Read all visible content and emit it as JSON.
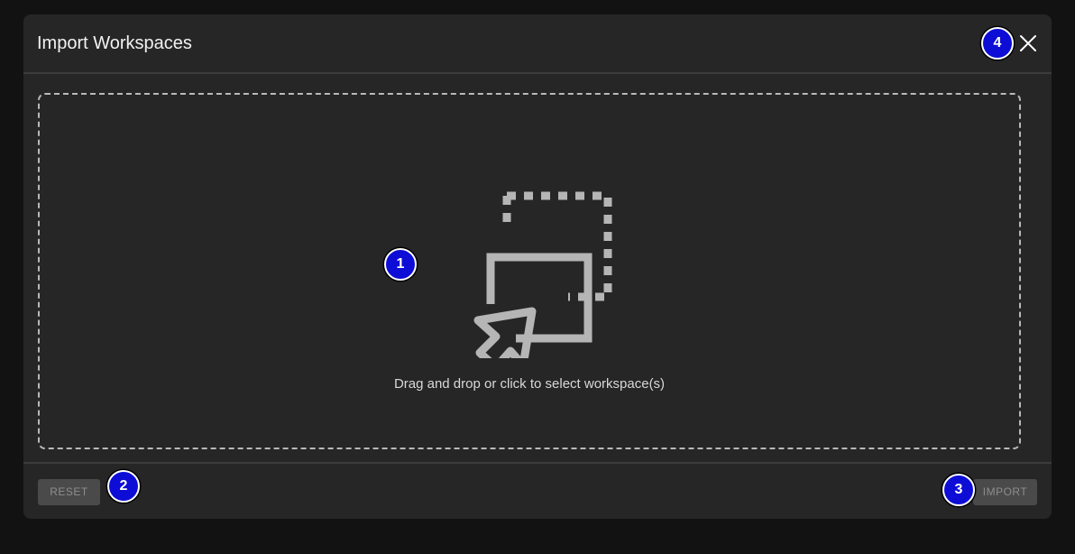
{
  "dialog": {
    "title": "Import Workspaces",
    "close_icon": "close-icon"
  },
  "dropzone": {
    "icon": "drag-drop-select-icon",
    "text": "Drag and drop or click to select workspace(s)"
  },
  "footer": {
    "reset_label": "RESET",
    "import_label": "IMPORT"
  },
  "markers": [
    "1",
    "2",
    "3",
    "4"
  ],
  "colors": {
    "page_background": "#121212",
    "dialog_background": "#262626",
    "marker_fill": "#0d0dd6",
    "disabled_button": "#4a4a4a"
  }
}
